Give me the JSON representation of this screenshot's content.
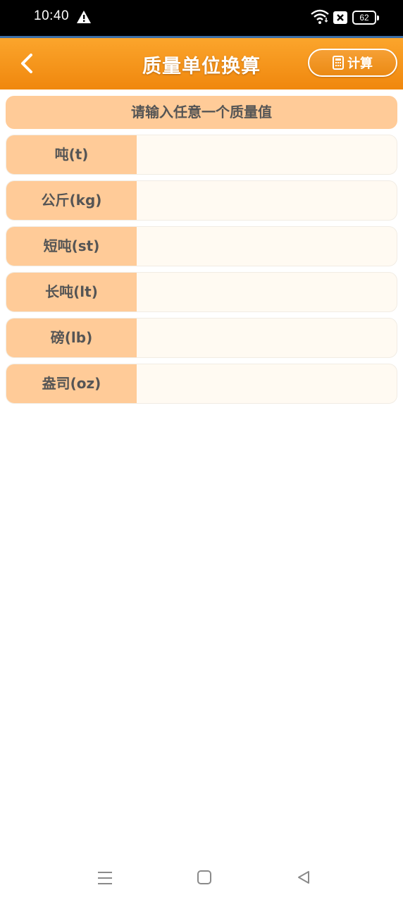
{
  "status_bar": {
    "time": "10:40",
    "battery": "62",
    "icons": [
      "warning-icon",
      "wifi-icon",
      "no-sim-icon",
      "battery-icon"
    ]
  },
  "header": {
    "title": "质量单位换算",
    "back_icon": "chevron-left-icon",
    "calc_button": {
      "label": "计算",
      "icon": "calculator-icon"
    },
    "color_top": "#fba52c",
    "color_bottom": "#f0870d"
  },
  "prompt": "请输入任意一个质量值",
  "units": [
    {
      "label": "吨(t)",
      "value": ""
    },
    {
      "label": "公斤(kg)",
      "value": ""
    },
    {
      "label": "短吨(st)",
      "value": ""
    },
    {
      "label": "长吨(lt)",
      "value": ""
    },
    {
      "label": "磅(lb)",
      "value": ""
    },
    {
      "label": "盎司(oz)",
      "value": ""
    }
  ],
  "colors": {
    "label_bg": "#ffcb98",
    "input_bg": "#fffaf2",
    "label_text": "#555555"
  },
  "nav_bar": {
    "icons": [
      "menu-icon",
      "home-icon",
      "back-triangle-icon"
    ]
  }
}
